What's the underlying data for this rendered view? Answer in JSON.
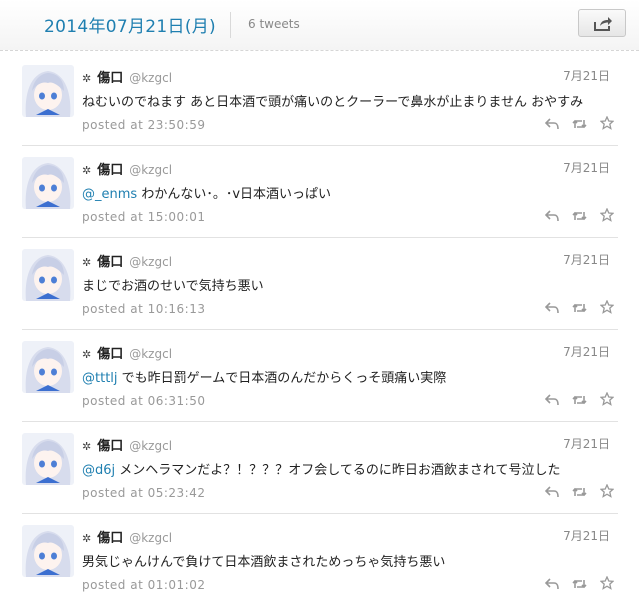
{
  "header": {
    "date": "2014年07月21日(月)",
    "count": "6 tweets"
  },
  "tweets": [
    {
      "name": "傷口",
      "handle": "@kzgcl",
      "date": "7月21日",
      "mention": "",
      "text": "ねむいのでねます あと日本酒で頭が痛いのとクーラーで鼻水が止まりません おやすみ",
      "posted": "posted at 23:50:59"
    },
    {
      "name": "傷口",
      "handle": "@kzgcl",
      "date": "7月21日",
      "mention": "@_enms",
      "text": " わかんない･。･v日本酒いっぱい",
      "posted": "posted at 15:00:01"
    },
    {
      "name": "傷口",
      "handle": "@kzgcl",
      "date": "7月21日",
      "mention": "",
      "text": "まじでお酒のせいで気持ち悪い",
      "posted": "posted at 10:16:13"
    },
    {
      "name": "傷口",
      "handle": "@kzgcl",
      "date": "7月21日",
      "mention": "@tttlj",
      "text": " でも昨日罰ゲームで日本酒のんだからくっそ頭痛い実際",
      "posted": "posted at 06:31:50"
    },
    {
      "name": "傷口",
      "handle": "@kzgcl",
      "date": "7月21日",
      "mention": "@d6j",
      "text": " メンヘラマンだよ？！？？？オフ会してるのに昨日お酒飲まされて号泣した",
      "posted": "posted at 05:23:42"
    },
    {
      "name": "傷口",
      "handle": "@kzgcl",
      "date": "7月21日",
      "mention": "",
      "text": "男気じゃんけんで負けて日本酒飲まされためっちゃ気持ち悪い",
      "posted": "posted at 01:01:02"
    }
  ]
}
